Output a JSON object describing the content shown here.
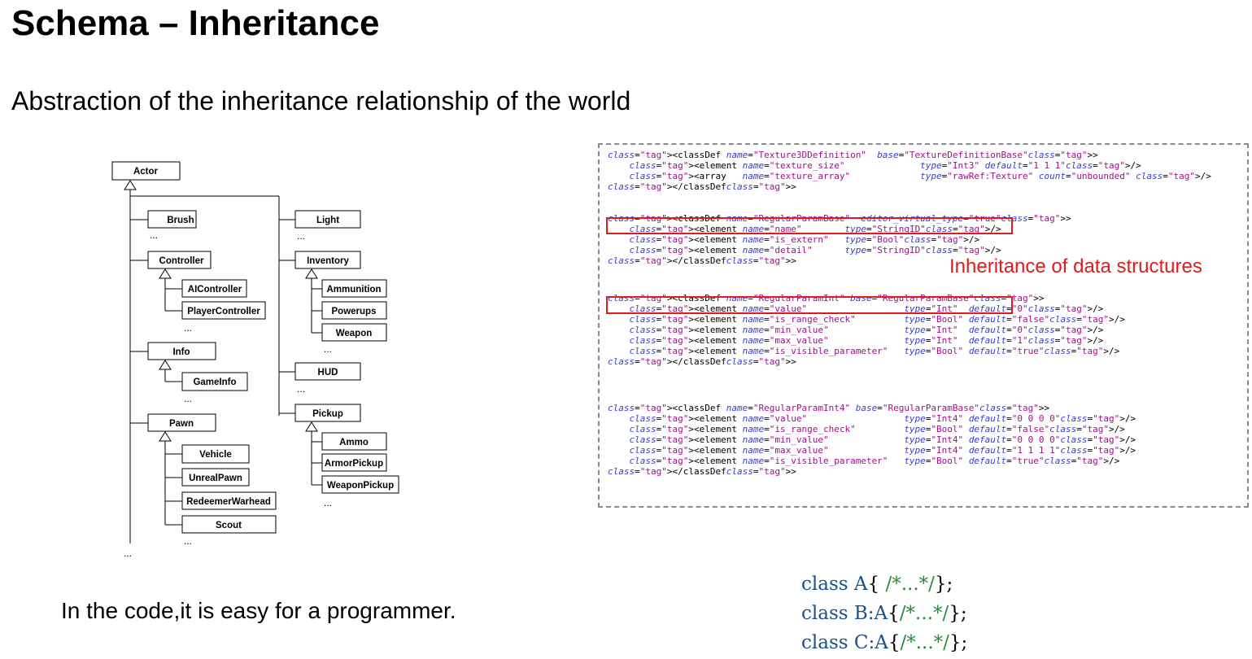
{
  "slide": {
    "title": "Schema – Inheritance",
    "subtitle": "Abstraction of the inheritance relationship of the world",
    "bottom_text": "In the code,it is easy for a programmer."
  },
  "tree": {
    "root": "Actor",
    "nodes": {
      "brush": "Brush",
      "controller": "Controller",
      "aicontroller": "AIController",
      "playercontroller": "PlayerController",
      "info": "Info",
      "gameinfo": "GameInfo",
      "pawn": "Pawn",
      "vehicle": "Vehicle",
      "unrealpawn": "UnrealPawn",
      "redeemerwarhead": "RedeemerWarhead",
      "scout": "Scout",
      "light": "Light",
      "inventory": "Inventory",
      "ammunition": "Ammunition",
      "powerups": "Powerups",
      "weapon": "Weapon",
      "hud": "HUD",
      "pickup": "Pickup",
      "ammo": "Ammo",
      "armorpickup": "ArmorPickup",
      "weaponpickup": "WeaponPickup"
    },
    "ellipsis": "..."
  },
  "xml": {
    "annotation": "Inheritance of data structures",
    "lines": [
      "<classDef name=\"Texture3DDefinition\"  base=\"TextureDefinitionBase\">",
      "    <element name=\"texture_size\"              type=\"Int3\" default=\"1 1 1\"/>",
      "    <array   name=\"texture_array\"             type=\"rawRef:Texture\" count=\"unbounded\" />",
      "</classDef>",
      "",
      "<classDef name=\"RegularParamBase\"  editor_virtual_type=\"true\">",
      "    <element name=\"name\"        type=\"StringID\"/>",
      "    <element name=\"is_extern\"   type=\"Bool\"/>",
      "    <element name=\"detail\"      type=\"StringID\"/>",
      "</classDef>",
      "",
      "<classDef name=\"RegularParamInt\" base=\"RegularParamBase\">",
      "    <element name=\"value\"                  type=\"Int\"  default=\"0\"/>",
      "    <element name=\"is_range_check\"         type=\"Bool\" default=\"false\"/>",
      "    <element name=\"min_value\"              type=\"Int\"  default=\"0\"/>",
      "    <element name=\"max_value\"              type=\"Int\"  default=\"1\"/>",
      "    <element name=\"is_visible_parameter\"   type=\"Bool\" default=\"true\"/>",
      "</classDef>",
      "",
      "<classDef name=\"RegularParamInt4\" base=\"RegularParamBase\">",
      "    <element name=\"value\"                  type=\"Int4\" default=\"0 0 0 0\"/>",
      "    <element name=\"is_range_check\"         type=\"Bool\" default=\"false\"/>",
      "    <element name=\"min_value\"              type=\"Int4\" default=\"0 0 0 0\"/>",
      "    <element name=\"max_value\"              type=\"Int4\" default=\"1 1 1 1\"/>",
      "    <element name=\"is_visible_parameter\"   type=\"Bool\" default=\"true\"/>",
      "</classDef>"
    ]
  },
  "cpp": {
    "lines": [
      "class A{ /*...*/};",
      "class B:A{/*...*/};",
      "class C:A{/*...*/};"
    ]
  }
}
